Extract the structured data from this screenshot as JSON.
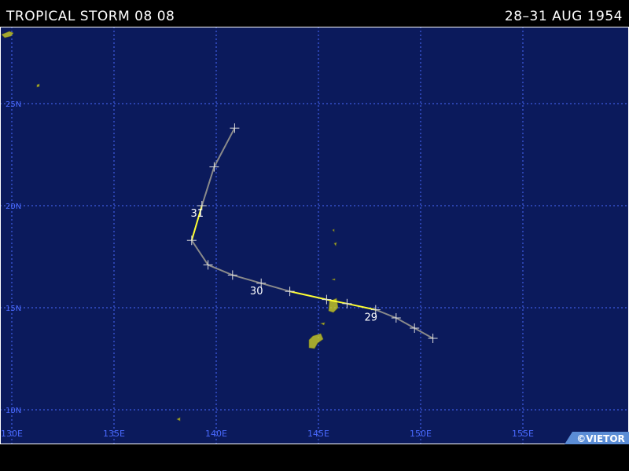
{
  "header": {
    "title": "TROPICAL STORM 08 08",
    "dates": "28–31 AUG 1954"
  },
  "map": {
    "background_color": "#0b1a5c",
    "grid_color": "#4a6aff",
    "land_color": "#d8d820",
    "lon_range": [
      130,
      160
    ],
    "lat_range": [
      8.5,
      28.8
    ],
    "lon_ticks": [
      {
        "value": 130,
        "label": "130E"
      },
      {
        "value": 135,
        "label": "135E"
      },
      {
        "value": 140,
        "label": "140E"
      },
      {
        "value": 145,
        "label": "145E"
      },
      {
        "value": 150,
        "label": "150E"
      },
      {
        "value": 155,
        "label": "155E"
      }
    ],
    "lat_ticks": [
      {
        "value": 10,
        "label": "10N"
      },
      {
        "value": 15,
        "label": "15N"
      },
      {
        "value": 20,
        "label": "20N"
      },
      {
        "value": 25,
        "label": "25N"
      }
    ],
    "credit": "©VIETOR"
  },
  "track": {
    "points": [
      {
        "lon": 150.6,
        "lat": 13.5,
        "intensity": "depression"
      },
      {
        "lon": 149.7,
        "lat": 14.0,
        "intensity": "depression"
      },
      {
        "lon": 148.8,
        "lat": 14.5,
        "intensity": "depression"
      },
      {
        "lon": 147.8,
        "lat": 14.9,
        "intensity": "storm"
      },
      {
        "lon": 146.4,
        "lat": 15.2,
        "intensity": "storm"
      },
      {
        "lon": 145.4,
        "lat": 15.4,
        "intensity": "storm"
      },
      {
        "lon": 143.6,
        "lat": 15.8,
        "intensity": "storm"
      },
      {
        "lon": 142.2,
        "lat": 16.2,
        "intensity": "depression"
      },
      {
        "lon": 140.8,
        "lat": 16.6,
        "intensity": "depression"
      },
      {
        "lon": 139.6,
        "lat": 17.1,
        "intensity": "depression"
      },
      {
        "lon": 138.8,
        "lat": 18.3,
        "intensity": "storm"
      },
      {
        "lon": 139.3,
        "lat": 20.0,
        "intensity": "storm"
      },
      {
        "lon": 139.9,
        "lat": 21.9,
        "intensity": "depression"
      },
      {
        "lon": 140.9,
        "lat": 23.8,
        "intensity": "depression"
      }
    ],
    "colors": {
      "depression": "#8a8a8a",
      "storm": "#ffff33",
      "marker": "#dddddd"
    },
    "day_labels": [
      {
        "text": "29",
        "lon": 147.8,
        "lat": 14.9
      },
      {
        "text": "30",
        "lon": 142.2,
        "lat": 16.2
      },
      {
        "text": "31",
        "lon": 139.3,
        "lat": 20.0
      }
    ]
  }
}
